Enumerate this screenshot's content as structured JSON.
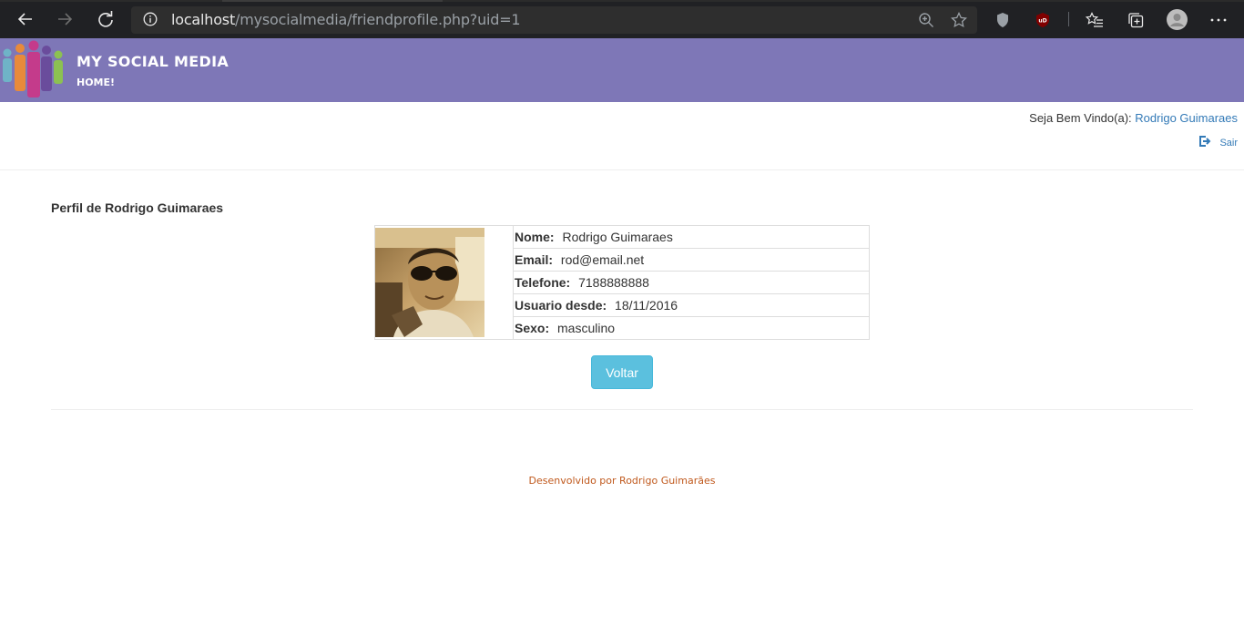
{
  "browser": {
    "url_host": "localhost",
    "url_path": "/mysocialmedia/friendprofile.php?uid=1"
  },
  "site": {
    "brand": "MY SOCIAL MEDIA",
    "home_link": "HOME!"
  },
  "session": {
    "welcome_label": "Seja Bem Vindo(a):",
    "user_name": "Rodrigo Guimaraes",
    "logout_label": "Sair"
  },
  "profile": {
    "title": "Perfil de Rodrigo Guimaraes",
    "fields": [
      {
        "label": "Nome:",
        "value": "Rodrigo Guimaraes"
      },
      {
        "label": "Email:",
        "value": "rod@email.net"
      },
      {
        "label": "Telefone:",
        "value": "7188888888"
      },
      {
        "label": "Usuario desde:",
        "value": "18/11/2016"
      },
      {
        "label": "Sexo:",
        "value": "masculino"
      }
    ],
    "back_button": "Voltar"
  },
  "footer": {
    "text": "Desenvolvido por Rodrigo Guimarães"
  },
  "colors": {
    "header_bg": "#7e77b7",
    "button_info": "#5bc0de",
    "link": "#337ab7",
    "footer_text": "#c0591d"
  },
  "icons": [
    "back-arrow-icon",
    "forward-arrow-icon",
    "refresh-icon",
    "info-icon",
    "zoom-icon",
    "favorite-star-icon",
    "shield-extension-icon",
    "ublock-extension-icon",
    "favorites-icon",
    "collections-icon",
    "profile-avatar-icon",
    "more-icon",
    "logout-icon"
  ]
}
